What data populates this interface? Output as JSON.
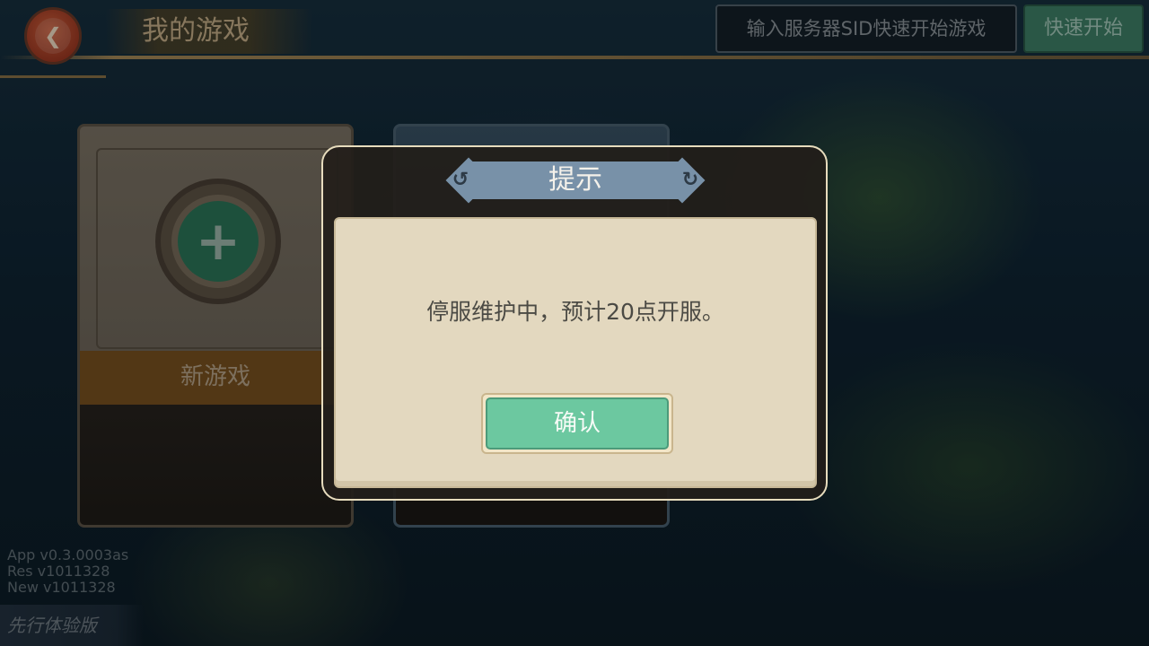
{
  "header": {
    "title": "我的游戏",
    "back_icon": "chevron-left-icon",
    "sid_placeholder": "输入服务器SID快速开始游戏",
    "quick_start_label": "快速开始"
  },
  "cards": {
    "new_game_label": "新游戏",
    "new_game_icon": "plus-icon"
  },
  "footer": {
    "version_lines": [
      "App   v0.3.0003as",
      "Res   v1011328",
      "New  v1011328"
    ],
    "badge": "先行体验版"
  },
  "modal": {
    "title": "提示",
    "message": "停服维护中，预计20点开服。",
    "confirm_label": "确认"
  },
  "colors": {
    "accent_green": "#6cc8a0",
    "title_banner": "#7891a8",
    "modal_paper": "#e3d8bf",
    "back_red": "#b8472c"
  }
}
